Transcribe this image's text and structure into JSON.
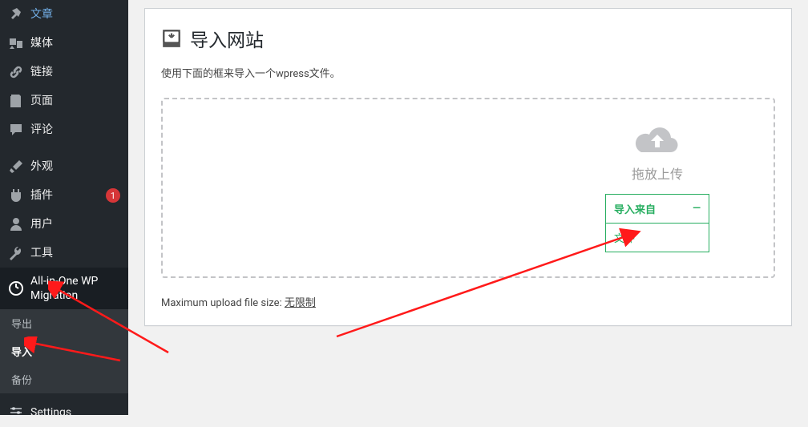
{
  "sidebar": {
    "items": [
      {
        "label": "文章"
      },
      {
        "label": "媒体"
      },
      {
        "label": "链接"
      },
      {
        "label": "页面"
      },
      {
        "label": "评论"
      },
      {
        "label": "外观"
      },
      {
        "label": "插件",
        "badge": "1"
      },
      {
        "label": "用户"
      },
      {
        "label": "工具"
      },
      {
        "label": "All-in-One WP Migration"
      },
      {
        "label": "Settings"
      }
    ],
    "submenu": [
      {
        "label": "导出"
      },
      {
        "label": "导入"
      },
      {
        "label": "备份"
      }
    ]
  },
  "panel": {
    "title": "导入网站",
    "desc": "使用下面的框来导入一个wpress文件。",
    "drop_text": "拖放上传",
    "import_from": "导入来自",
    "file_option": "文件",
    "max_label": "Maximum upload file size: ",
    "max_value": "无限制"
  }
}
